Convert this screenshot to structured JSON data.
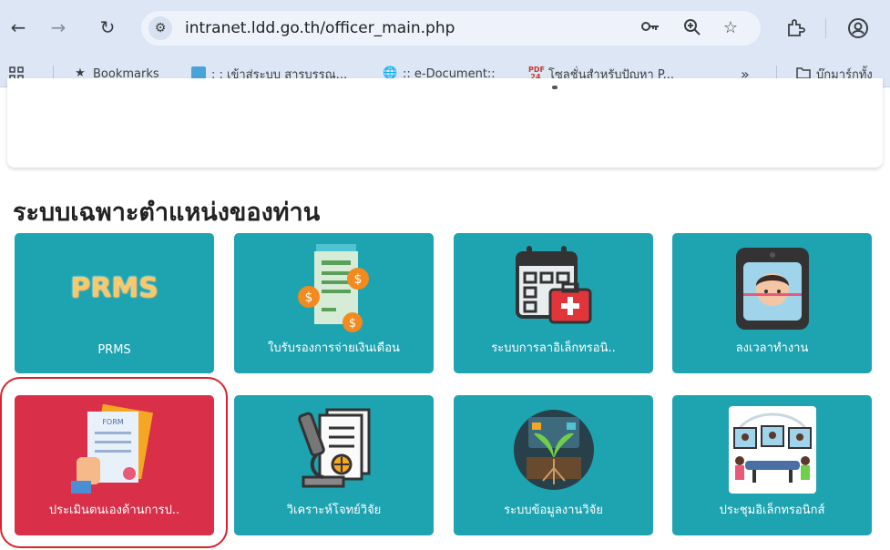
{
  "browser": {
    "url": "intranet.ldd.go.th/officer_main.php"
  },
  "bookmarks": {
    "items": [
      {
        "label": "Bookmarks"
      },
      {
        "label": ": : เข้าสู่ระบบ สารบรรณ..."
      },
      {
        "label": ":: e-Document::"
      },
      {
        "label": "โซลูชั่นสำหรับปัญหา P..."
      }
    ],
    "overflow": "»",
    "folder": "บุ๊กมาร์กทั้ง"
  },
  "section": {
    "title": "ระบบเฉพาะตำแหน่งของท่าน"
  },
  "tiles": [
    {
      "label": "PRMS",
      "logo": "PRMS"
    },
    {
      "label": "ใบรับรองการจ่ายเงินเดือน"
    },
    {
      "label": "ระบบการลาอิเล็กทรอนิ.."
    },
    {
      "label": "ลงเวลาทำงาน"
    },
    {
      "label": "ประเมินตนเองด้านการป..",
      "form_text": "FORM"
    },
    {
      "label": "วิเคราะห์โจทย์วิจัย"
    },
    {
      "label": "ระบบข้อมูลงานวิจัย"
    },
    {
      "label": "ประชุมอิเล็กทรอนิกส์"
    }
  ],
  "colors": {
    "tile_teal": "#1ea3b0",
    "tile_red": "#d92f49",
    "highlight": "#d9232e",
    "chrome": "#dce6f5"
  }
}
